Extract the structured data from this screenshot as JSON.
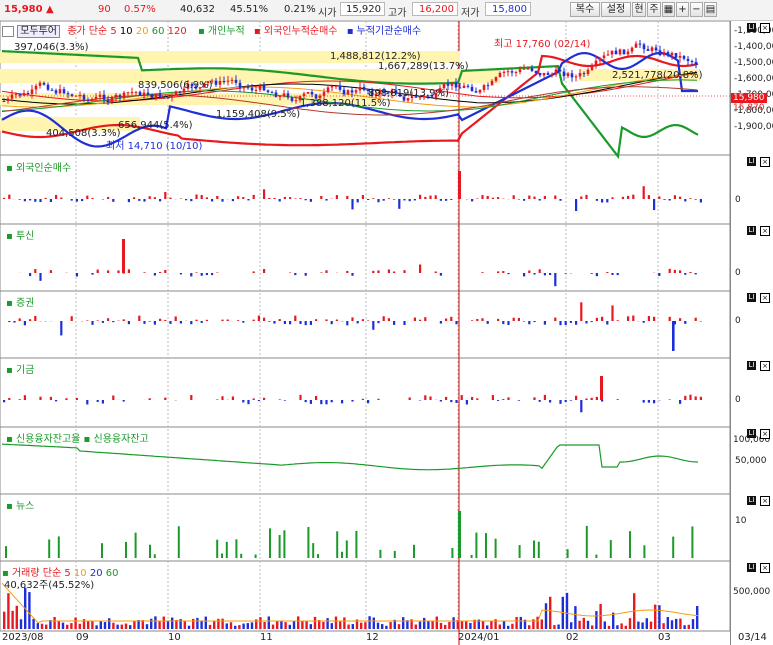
{
  "topbar": {
    "price": "15,980",
    "arrow": "▲",
    "change": "90",
    "change_pct": "0.57%",
    "volume": "40,632",
    "ratio1": "45.51%",
    "ratio2": "0.21%",
    "open_label": "시가",
    "open_value": "15,920",
    "high_label": "고가",
    "high_value": "16,200",
    "low_label": "저가",
    "low_value": "15,800",
    "btn_copy": "복수",
    "btn_settings": "설정",
    "btn_current": "현",
    "btn_week": "주"
  },
  "price_panel": {
    "legend_name": "모두투어",
    "legend_ma": "종가 단순 5",
    "legend_10": "10",
    "legend_20": "20",
    "legend_60": "60",
    "legend_120": "120",
    "legend_individual": "개인누적",
    "legend_foreign": "외국인누적순매수",
    "legend_inst": "누적기관순매수",
    "high_note": "최고 17,760 (02/14)",
    "low_note": "최저 14,710 (10/10)",
    "last_price_tag": "15,980",
    "last_price_tag2": "15,870",
    "annotations": [
      "397,046(3.3%)",
      "1,488,812(12.2%)",
      "1,667,289(13.7%)",
      "839,506(6.9%)",
      "2,521,778(20.8%)",
      "1,388,120(11.5%)",
      "898,819(13.9%)",
      "1,159,408(9.5%)",
      "656,944(5.4%)",
      "404,508(3.3%)"
    ],
    "y_ticks": [
      "1,300,000",
      "1,400,000",
      "1,500,000",
      "1,600,000",
      "1,700,000",
      "1,800,000",
      "1,900,000"
    ]
  },
  "panels": {
    "foreign": {
      "label": "외국인순매수",
      "zero": "0"
    },
    "trust": {
      "label": "투신",
      "zero": "0"
    },
    "securities": {
      "label": "증권",
      "zero": "0"
    },
    "other": {
      "label": "기금",
      "zero": "0"
    },
    "credit": {
      "label1": "신용융자잔고율",
      "label2": "신용융자잔고",
      "tick1": "100,000",
      "tick2": "50,000"
    },
    "news": {
      "label": "뉴스",
      "tick": "10"
    },
    "volume": {
      "label": "거래량",
      "ma": "단순 5",
      "ma10": "10",
      "ma20": "20",
      "ma60": "60",
      "value": "40,632주(45.52%)",
      "tick": "500,000"
    }
  },
  "x_axis": [
    "2023/08",
    "09",
    "10",
    "11",
    "12",
    "2024/01",
    "02",
    "03",
    "03/14"
  ],
  "colors": {
    "up": "#e8191e",
    "down": "#1f2fd8",
    "green": "#1a9a2a"
  }
}
